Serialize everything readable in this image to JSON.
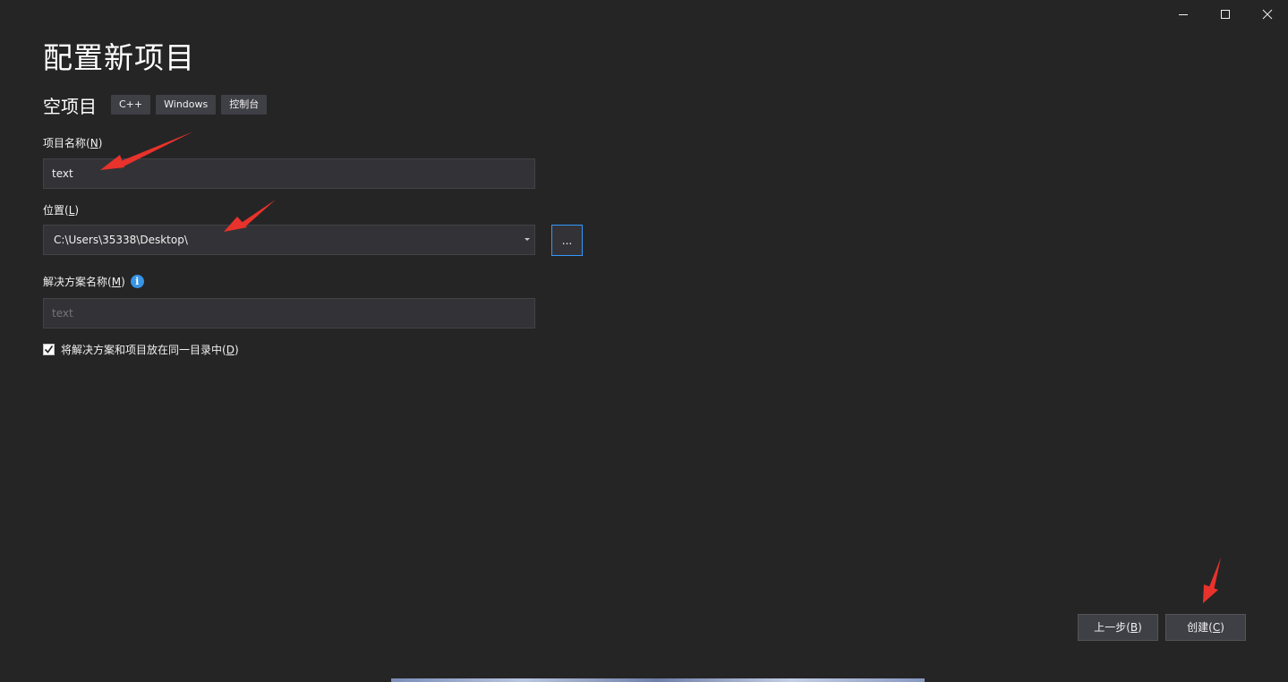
{
  "window": {
    "controls": [
      "minimize-icon",
      "maximize-icon",
      "close-icon"
    ]
  },
  "page": {
    "title": "配置新项目"
  },
  "template": {
    "name": "空项目",
    "tags": [
      "C++",
      "Windows",
      "控制台"
    ]
  },
  "project_name": {
    "label": "项目名称",
    "mnemonic": "N",
    "value": "text"
  },
  "location": {
    "label": "位置",
    "mnemonic": "L",
    "value": "C:\\Users\\35338\\Desktop\\",
    "browse_label": "..."
  },
  "solution_name": {
    "label": "解决方案名称",
    "mnemonic": "M",
    "info_icon": "i",
    "placeholder": "text"
  },
  "same_directory": {
    "label": "将解决方案和项目放在同一目录中",
    "mnemonic": "D",
    "checked": true
  },
  "footer": {
    "back_label": "上一步",
    "back_mnemonic": "B",
    "create_label": "创建",
    "create_mnemonic": "C"
  },
  "colors": {
    "background": "#252526",
    "input_bg": "#333337",
    "focus_border": "#3399ff",
    "annotation_arrow": "#e8322b",
    "info_blue": "#3794e5"
  }
}
